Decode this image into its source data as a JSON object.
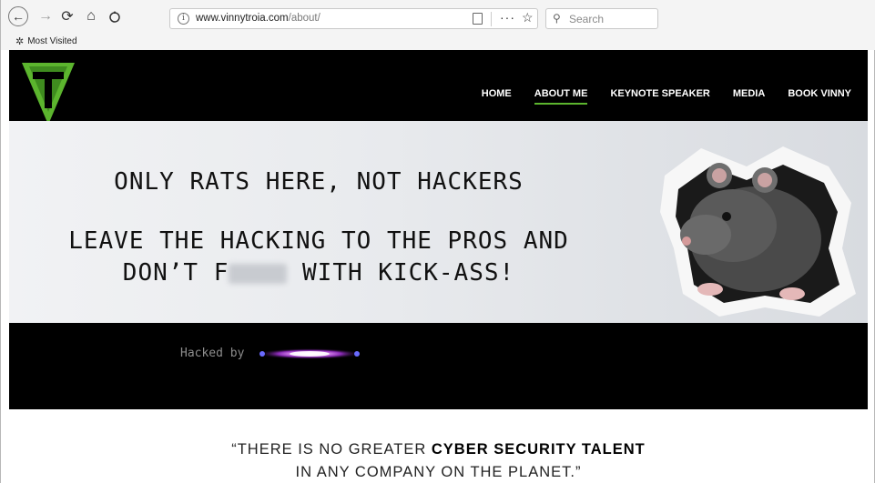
{
  "browser": {
    "url_host": "www.vinnytroia.com",
    "url_path": "/about/",
    "search_placeholder": "Search",
    "bookmark": "Most Visited"
  },
  "site": {
    "nav": [
      "HOME",
      "ABOUT ME",
      "KEYNOTE SPEAKER",
      "MEDIA",
      "BOOK VINNY"
    ],
    "active_nav": "ABOUT ME",
    "accent": "#5cb52e"
  },
  "hero": {
    "line1": "ONLY RATS HERE, NOT HACKERS",
    "line2": "LEAVE THE HACKING TO THE PROS AND",
    "line3_pre": "DON’T F",
    "line3_post": " WITH KICK-ASS!"
  },
  "banner": {
    "hacked_by": "Hacked by"
  },
  "quote": {
    "pre": "“THERE IS NO GREATER ",
    "bold": "CYBER SECURITY TALENT",
    "line2": "IN ANY COMPANY ON THE PLANET.”"
  }
}
